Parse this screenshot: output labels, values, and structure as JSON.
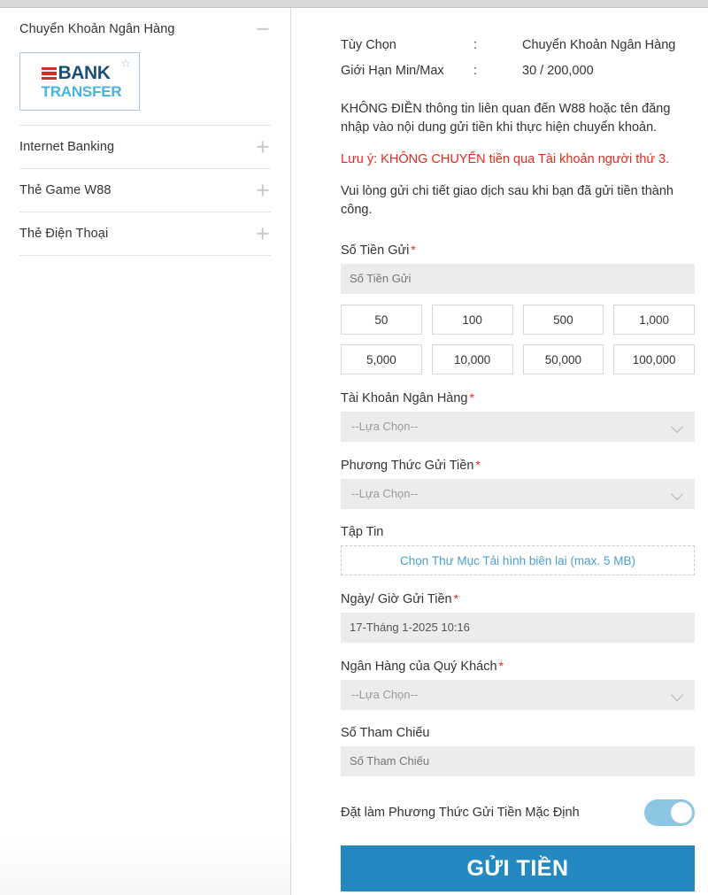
{
  "window": {
    "top_bar_color": "#d8d8d8"
  },
  "colors": {
    "accent_blue": "#2389c0",
    "link_blue": "#4a9fd0",
    "warning_red": "#e8291e",
    "toggle_on": "#8cc6e2",
    "input_bg": "#ececec"
  },
  "sidebar": {
    "groups": [
      {
        "title": "Chuyển Khoản Ngân Hàng",
        "toggle_icon": "minus-icon",
        "expanded": true,
        "logo": {
          "bank_text": "BANK",
          "transfer_text": "TRANSFER",
          "star_glyph": "☆"
        }
      },
      {
        "title": "Internet Banking",
        "toggle_icon": "plus-icon",
        "expanded": false
      },
      {
        "title": "Thẻ Game W88",
        "toggle_icon": "plus-icon",
        "expanded": false
      },
      {
        "title": "Thẻ Điện Thoại",
        "toggle_icon": "plus-icon",
        "expanded": false
      }
    ]
  },
  "detail": {
    "summary": [
      {
        "label": "Tùy Chọn",
        "colon": ":",
        "value": "Chuyển Khoản Ngân Hàng"
      },
      {
        "label": "Giới Hạn Min/Max",
        "colon": ":",
        "value": "30 / 200,000"
      }
    ],
    "notices": {
      "info": "KHÔNG ĐIỀN thông tin liên quan đến W88 hoặc tên đăng nhập vào nội dung gửi tiền khi thực hiện chuyển khoản.",
      "warning": "Lưu ý: KHÔNG CHUYỂN tiền qua Tài khoản người thứ 3.",
      "footer": "Vui lòng gửi chi tiết giao dịch sau khi bạn đã gửi tiền thành công."
    },
    "form": {
      "amount": {
        "label": "Số Tiền Gửi",
        "required_mark": "*",
        "placeholder": "Số Tiền Gửi",
        "value": ""
      },
      "quick_amounts": [
        "50",
        "100",
        "500",
        "1,000",
        "5,000",
        "10,000",
        "50,000",
        "100,000"
      ],
      "bank_account": {
        "label": "Tài Khoản Ngân Hàng",
        "required_mark": "*",
        "selected": "--Lựa Chọn--"
      },
      "deposit_method": {
        "label": "Phương Thức Gửi Tiền",
        "required_mark": "*",
        "selected": "--Lựa Chọn--"
      },
      "file": {
        "label": "Tập Tin",
        "button_text": "Chọn Thư Mục Tải hình biên lai (max. 5 MB)"
      },
      "datetime": {
        "label": "Ngày/ Giờ Gửi Tiền",
        "required_mark": "*",
        "value": "17-Tháng 1-2025 10:16"
      },
      "customer_bank": {
        "label": "Ngân Hàng của Quý Khách",
        "required_mark": "*",
        "selected": "--Lựa Chọn--"
      },
      "reference": {
        "label": "Số Tham Chiếu",
        "placeholder": "Số Tham Chiếu",
        "value": ""
      },
      "default_method": {
        "label": "Đặt làm Phương Thức Gửi Tiền Mặc Định",
        "state": "on"
      },
      "submit_label": "GỬI TIỀN"
    }
  }
}
